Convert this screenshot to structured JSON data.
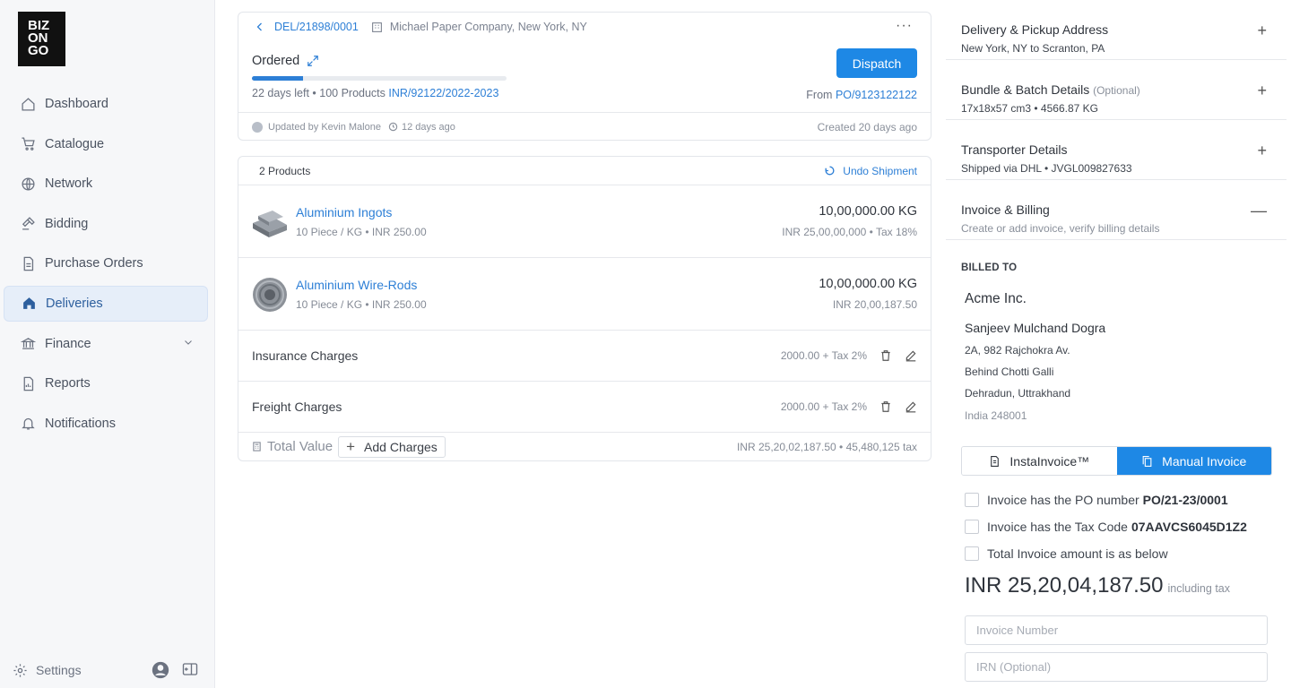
{
  "logo": {
    "lines": [
      "BIZ",
      "ON",
      "GO"
    ]
  },
  "sidebar": {
    "items": [
      {
        "label": "Dashboard",
        "icon": "home-icon"
      },
      {
        "label": "Catalogue",
        "icon": "cart-icon"
      },
      {
        "label": "Network",
        "icon": "globe-icon"
      },
      {
        "label": "Bidding",
        "icon": "gavel-icon"
      },
      {
        "label": "Purchase Orders",
        "icon": "document-icon"
      },
      {
        "label": "Deliveries",
        "icon": "home-filled-icon",
        "active": true
      },
      {
        "label": "Finance",
        "icon": "bank-icon",
        "has_submenu": true
      },
      {
        "label": "Reports",
        "icon": "report-icon"
      },
      {
        "label": "Notifications",
        "icon": "bell-icon"
      }
    ],
    "settings_label": "Settings"
  },
  "header": {
    "doc_id": "DEL/21898/0001",
    "company": "Michael Paper Company, New York, NY",
    "more": "···",
    "status": "Ordered",
    "progress": 0.2,
    "meta_prefix": "22 days left • 100 Products ",
    "meta_link": "INR/92122/2022-2023",
    "dispatch_label": "Dispatch",
    "from_prefix": "From ",
    "from_link": "PO/9123122122",
    "updated_by": "Updated by Kevin Malone",
    "updated_ago": "12 days ago",
    "created": "Created 20 days ago"
  },
  "products": {
    "count_label": "2 Products",
    "undo_label": "Undo Shipment",
    "items": [
      {
        "name": "Aluminium Ingots",
        "sub": "10 Piece / KG • INR 250.00",
        "qty": "10,00,000.00 KG",
        "price": "INR 25,00,00,000 • Tax 18%"
      },
      {
        "name": "Aluminium Wire-Rods",
        "sub": "10 Piece / KG • INR 250.00",
        "qty": "10,00,000.00 KG",
        "price": "INR 20,00,187.50"
      }
    ],
    "charges": [
      {
        "label": "Insurance Charges",
        "value": "2000.00 + Tax 2%"
      },
      {
        "label": "Freight Charges",
        "value": "2000.00 + Tax 2%"
      }
    ],
    "total_label": "Total Value",
    "add_charges_label": "Add Charges",
    "total_value": "INR 25,20,02,187.50 • 45,480,125 tax"
  },
  "right": {
    "sections": [
      {
        "title": "Delivery & Pickup Address",
        "optional": "",
        "sub": "New York, NY to Scranton, PA",
        "toggle": "+"
      },
      {
        "title": "Bundle & Batch Details",
        "optional": "(Optional)",
        "sub": "17x18x57 cm3 • 4566.87 KG",
        "toggle": "+"
      },
      {
        "title": "Transporter Details",
        "optional": "",
        "sub": "Shipped via DHL • JVGL009827633",
        "toggle": "+"
      },
      {
        "title": "Invoice & Billing",
        "optional": "",
        "sub": "Create or add invoice, verify billing details",
        "toggle": "—"
      }
    ],
    "billed_to_label": "BILLED TO",
    "company": "Acme Inc.",
    "name": "Sanjeev Mulchand Dogra",
    "address": [
      "2A, 982 Rajchokra Av.",
      "Behind Chotti Galli",
      "Dehradun, Uttrakhand",
      "India 248001"
    ],
    "tabs": {
      "insta": "InstaInvoice™",
      "manual": "Manual Invoice"
    },
    "checks": [
      {
        "text": "Invoice has the PO number",
        "bold": "PO/21-23/0001"
      },
      {
        "text": "Invoice has the Tax Code",
        "bold": "07AAVCS6045D1Z2"
      },
      {
        "text": "Total Invoice amount is as below",
        "bold": ""
      }
    ],
    "amount": "INR 25,20,04,187.50",
    "amount_note": "including tax",
    "invoice_placeholder": "Invoice Number",
    "irn_placeholder": "IRN (Optional)"
  },
  "colors": {
    "accent": "#1e88e5",
    "link": "#2d7fd6",
    "active_nav_bg": "#e6eef9"
  }
}
